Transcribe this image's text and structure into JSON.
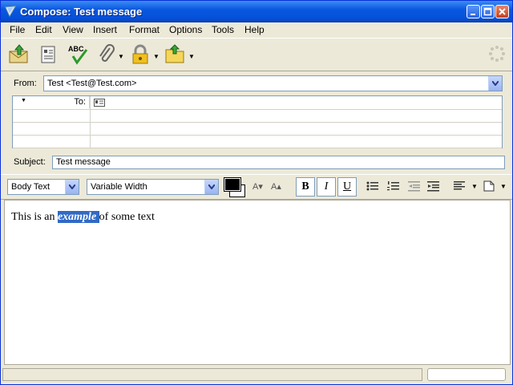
{
  "window": {
    "title": "Compose: Test message"
  },
  "menu": {
    "items": [
      "File",
      "Edit",
      "View",
      "Insert",
      "Format",
      "Options",
      "Tools",
      "Help"
    ]
  },
  "toolbar": {
    "icons": [
      "send-icon",
      "address-book-icon",
      "spellcheck-icon",
      "attach-icon",
      "security-lock-icon",
      "save-folder-icon",
      "throbber-icon"
    ],
    "spell_label": "ABC"
  },
  "header": {
    "from_label": "From:",
    "from_value": "Test <Test@Test.com>",
    "to_label": "To:",
    "subject_label": "Subject:",
    "subject_value": "Test message"
  },
  "format": {
    "paragraph_style": "Body Text",
    "font": "Variable Width",
    "bold": "B",
    "italic": "I",
    "underline": "U",
    "smaller_label": "A",
    "larger_label": "A"
  },
  "body": {
    "text_before": "This is an ",
    "selected": "example ",
    "text_after": "of some text"
  },
  "colors": {
    "titlebar": "#0550d8",
    "selection": "#316ac5",
    "chrome": "#ece9d8"
  }
}
